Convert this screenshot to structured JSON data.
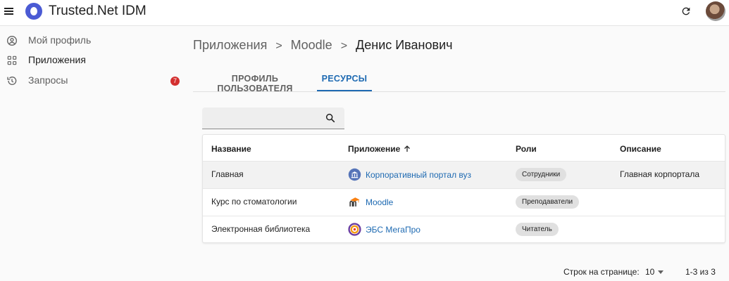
{
  "header": {
    "app_title": "Trusted.Net IDM",
    "icons": {
      "menu": "menu-icon",
      "logo": "app-logo",
      "refresh": "refresh-icon",
      "avatar": "user-avatar"
    }
  },
  "sidebar": {
    "items": [
      {
        "label": "Мой профиль",
        "icon": "account-circle-icon",
        "active": false
      },
      {
        "label": "Приложения",
        "icon": "apps-grid-icon",
        "active": true
      },
      {
        "label": "Запросы",
        "icon": "history-icon",
        "active": false,
        "badge": "7"
      }
    ],
    "badge_color": "#d32f2f"
  },
  "breadcrumb": {
    "items": [
      "Приложения",
      "Moodle",
      "Денис Иванович"
    ],
    "separator": ">"
  },
  "tabs": [
    {
      "label": "ПРОФИЛЬ ПОЛЬЗОВАТЕЛЯ",
      "active": false
    },
    {
      "label": "РЕСУРСЫ",
      "active": true
    }
  ],
  "search": {
    "value": "",
    "placeholder": ""
  },
  "table": {
    "columns": [
      "Название",
      "Приложение",
      "Роли",
      "Описание"
    ],
    "sort_column": "Приложение",
    "sort_direction": "ascending",
    "rows": [
      {
        "name": "Главная",
        "app": "Корпоративный портал вуз",
        "app_icon": "university-building-icon",
        "role": "Сотрудники",
        "description": "Главная корпортала"
      },
      {
        "name": "Курс по стоматологии",
        "app": "Moodle",
        "app_icon": "moodle-logo-icon",
        "role": "Преподаватели",
        "description": ""
      },
      {
        "name": "Электронная библиотека",
        "app": "ЭБС МегаПро",
        "app_icon": "megapro-logo-icon",
        "role": "Читатель",
        "description": ""
      }
    ]
  },
  "pagination": {
    "rows_per_page_label": "Строк на странице:",
    "rows_per_page": "10",
    "range": "1-3 из 3"
  },
  "colors": {
    "accent": "#1e6ab2",
    "logo": "#4b5bd4",
    "chip_bg": "#e0e0e0"
  }
}
